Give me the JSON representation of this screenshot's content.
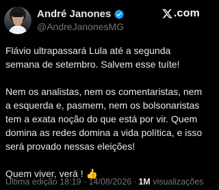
{
  "author": {
    "display_name": "André Janones",
    "handle": "@AndreJanonesMG"
  },
  "brand": {
    "suffix": ".com"
  },
  "tweet": {
    "paragraphs": [
      "Flávio ultrapassará Lula até a segunda semana de setembro.  Salvem esse tuíte!",
      "Nem os analistas, nem os comentaristas, nem a esquerda e, pasmem, nem os bolsonaristas tem a exata noção do que está por vir. Quem domina as redes domina a vida política, e isso será provado nessas eleições!",
      "Quem viver, verá ! 👍"
    ]
  },
  "meta": {
    "edited_label": "Última edição 18:19 · 14/08/2026",
    "separator": "·",
    "views_count": "1M",
    "views_label": "visualizações"
  },
  "icons": {
    "verified": "verified-badge-icon",
    "brand": "x-logo-icon"
  },
  "colors": {
    "background": "#000000",
    "text": "#e7e9ea",
    "secondary": "#71767b",
    "verified": "#1d9bf0"
  }
}
